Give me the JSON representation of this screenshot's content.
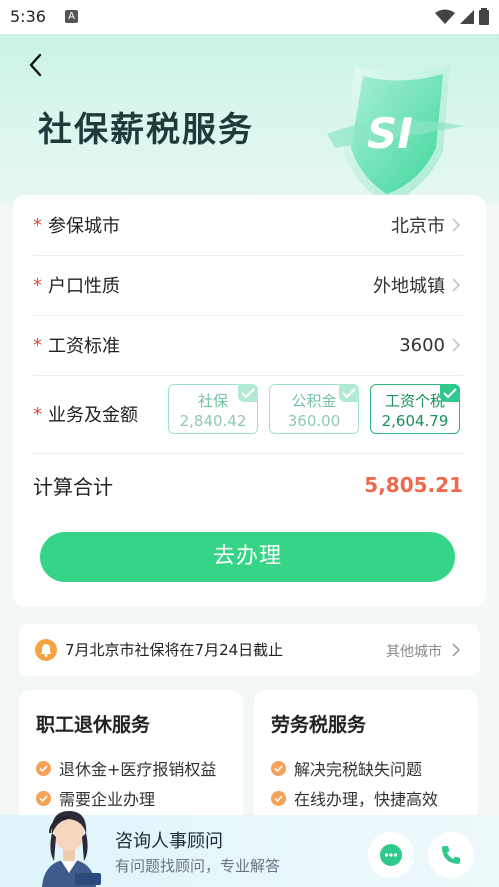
{
  "status": {
    "time": "5:36",
    "badge": "A"
  },
  "header": {
    "title": "社保薪税服务",
    "shield_text": "SI"
  },
  "form": {
    "rows": [
      {
        "label": "参保城市",
        "value": "北京市",
        "required": true
      },
      {
        "label": "户口性质",
        "value": "外地城镇",
        "required": true
      },
      {
        "label": "工资标准",
        "value": "3600",
        "required": true
      },
      {
        "label": "业务及金额",
        "required": true
      }
    ],
    "chips": [
      {
        "name": "社保",
        "amount": "2,840.42",
        "checked": true,
        "active": false
      },
      {
        "name": "公积金",
        "amount": "360.00",
        "checked": true,
        "active": false
      },
      {
        "name": "工资个税",
        "amount": "2,604.79",
        "checked": true,
        "active": true
      }
    ],
    "total_label": "计算合计",
    "total_value": "5,805.21",
    "submit_label": "去办理"
  },
  "notice": {
    "text": "7月北京市社保将在7月24日截止",
    "link": "其他城市"
  },
  "services": [
    {
      "title": "职工退休服务",
      "items": [
        "退休金+医疗报销权益",
        "需要企业办理"
      ]
    },
    {
      "title": "劳务税服务",
      "items": [
        "解决完税缺失问题",
        "在线办理，快捷高效"
      ]
    }
  ],
  "consult": {
    "title": "咨询人事顾问",
    "subtitle": "有问题找顾问，专业解答"
  },
  "colors": {
    "accent": "#35d486",
    "total": "#f0694d",
    "required": "#e04a3a"
  }
}
